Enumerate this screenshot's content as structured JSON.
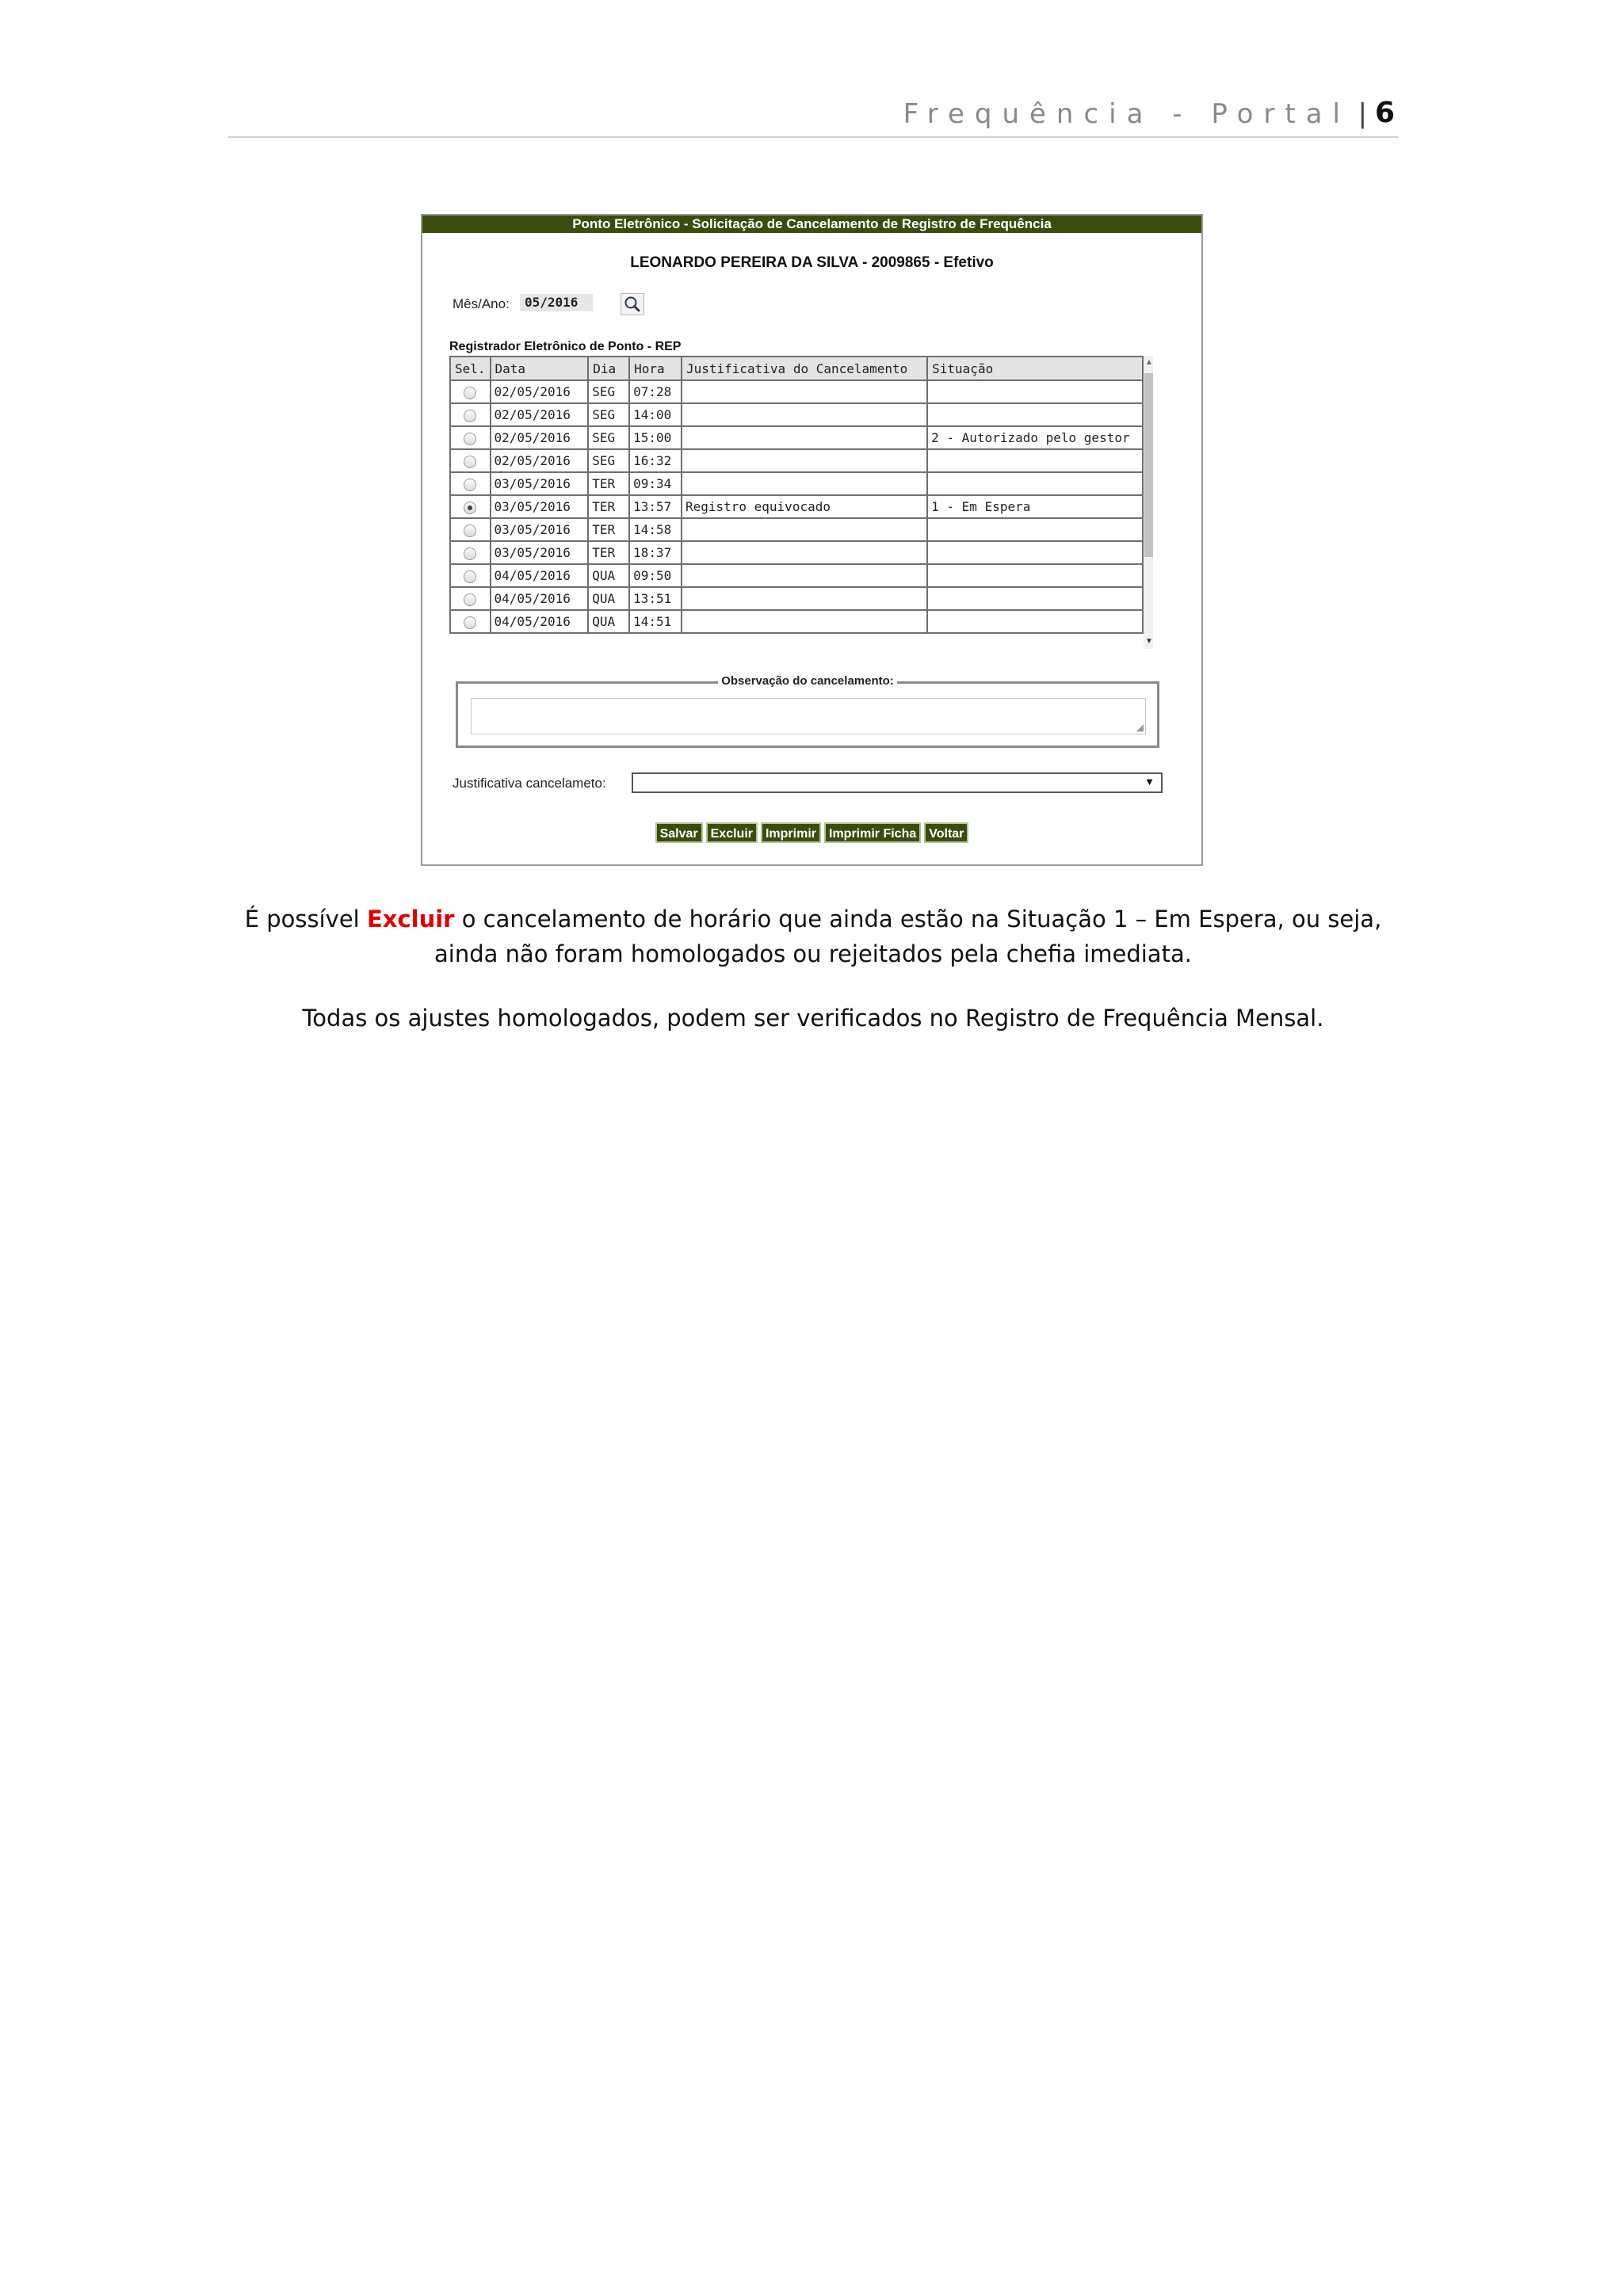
{
  "header": {
    "title": "Frequência - Portal",
    "separator": "|",
    "page_number": "6"
  },
  "screen": {
    "title": "Ponto Eletrônico - Solicitação de Cancelamento de Registro de Frequência",
    "employee": "LEONARDO PEREIRA DA SILVA - 2009865 - Efetivo",
    "mesano_label": "Mês/Ano:",
    "mesano_value": "05/2016",
    "rep_label": "Registrador Eletrônico de Ponto - REP",
    "columns": [
      "Sel.",
      "Data",
      "Dia",
      "Hora",
      "Justificativa do Cancelamento",
      "Situação"
    ],
    "rows": [
      {
        "selected": false,
        "data": "02/05/2016",
        "dia": "SEG",
        "hora": "07:28",
        "justificativa": "",
        "situacao": ""
      },
      {
        "selected": false,
        "data": "02/05/2016",
        "dia": "SEG",
        "hora": "14:00",
        "justificativa": "",
        "situacao": ""
      },
      {
        "selected": false,
        "data": "02/05/2016",
        "dia": "SEG",
        "hora": "15:00",
        "justificativa": "",
        "situacao": "2 - Autorizado pelo gestor"
      },
      {
        "selected": false,
        "data": "02/05/2016",
        "dia": "SEG",
        "hora": "16:32",
        "justificativa": "",
        "situacao": ""
      },
      {
        "selected": false,
        "data": "03/05/2016",
        "dia": "TER",
        "hora": "09:34",
        "justificativa": "",
        "situacao": ""
      },
      {
        "selected": true,
        "data": "03/05/2016",
        "dia": "TER",
        "hora": "13:57",
        "justificativa": "Registro equivocado",
        "situacao": "1 - Em Espera"
      },
      {
        "selected": false,
        "data": "03/05/2016",
        "dia": "TER",
        "hora": "14:58",
        "justificativa": "",
        "situacao": ""
      },
      {
        "selected": false,
        "data": "03/05/2016",
        "dia": "TER",
        "hora": "18:37",
        "justificativa": "",
        "situacao": ""
      },
      {
        "selected": false,
        "data": "04/05/2016",
        "dia": "QUA",
        "hora": "09:50",
        "justificativa": "",
        "situacao": ""
      },
      {
        "selected": false,
        "data": "04/05/2016",
        "dia": "QUA",
        "hora": "13:51",
        "justificativa": "",
        "situacao": ""
      },
      {
        "selected": false,
        "data": "04/05/2016",
        "dia": "QUA",
        "hora": "14:51",
        "justificativa": "",
        "situacao": ""
      }
    ],
    "observacao_legend": "Observação do cancelamento:",
    "observacao_value": "",
    "justificativa_label": "Justificativa cancelameto:",
    "justificativa_value": "",
    "buttons": {
      "salvar": "Salvar",
      "excluir": "Excluir",
      "imprimir": "Imprimir",
      "imprimir_ficha": "Imprimir Ficha",
      "voltar": "Voltar"
    },
    "colors": {
      "title_bar": "#3a4d0f",
      "button": "#3a4d0f"
    }
  },
  "text": {
    "p1_a": "É possível ",
    "p1_highlight": "Excluir",
    "p1_b": " o cancelamento de horário que ainda estão na Situação 1 – Em Espera, ou seja, ainda não foram homologados ou rejeitados pela chefia imediata.",
    "p2": "Todas os ajustes homologados, podem ser verificados no Registro de Frequência Mensal.",
    "highlight_color": "#e00000"
  }
}
